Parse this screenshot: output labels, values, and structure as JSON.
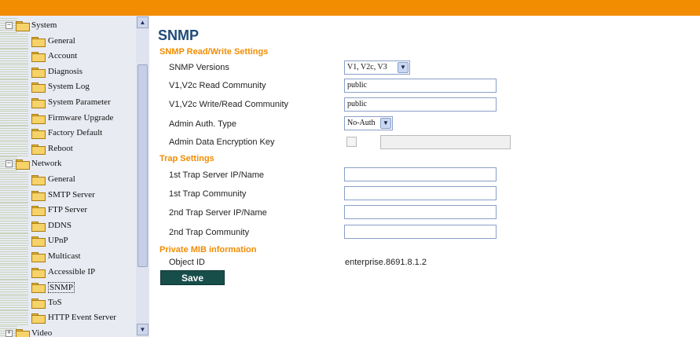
{
  "sidebar": {
    "items": [
      {
        "label": "System",
        "kind": "folder",
        "expander": "−"
      },
      {
        "label": "General",
        "kind": "page"
      },
      {
        "label": "Account",
        "kind": "page"
      },
      {
        "label": "Diagnosis",
        "kind": "page"
      },
      {
        "label": "System Log",
        "kind": "page"
      },
      {
        "label": "System Parameter",
        "kind": "page"
      },
      {
        "label": "Firmware Upgrade",
        "kind": "page"
      },
      {
        "label": "Factory Default",
        "kind": "page"
      },
      {
        "label": "Reboot",
        "kind": "page"
      },
      {
        "label": "Network",
        "kind": "folder",
        "expander": "−"
      },
      {
        "label": "General",
        "kind": "page"
      },
      {
        "label": "SMTP Server",
        "kind": "page"
      },
      {
        "label": "FTP Server",
        "kind": "page"
      },
      {
        "label": "DDNS",
        "kind": "page"
      },
      {
        "label": "UPnP",
        "kind": "page"
      },
      {
        "label": "Multicast",
        "kind": "page"
      },
      {
        "label": "Accessible IP",
        "kind": "page"
      },
      {
        "label": "SNMP",
        "kind": "page",
        "selected": true
      },
      {
        "label": "ToS",
        "kind": "page"
      },
      {
        "label": "HTTP Event Server",
        "kind": "page"
      },
      {
        "label": "Video",
        "kind": "folder",
        "expander": "+"
      }
    ],
    "scroll_up": "▲",
    "scroll_down": "▼"
  },
  "main": {
    "title": "SNMP",
    "rw_section": "SNMP Read/Write Settings",
    "snmp_versions_label": "SNMP Versions",
    "snmp_versions_value": "V1, V2c, V3",
    "read_community_label": "V1,V2c Read Community",
    "read_community_value": "public",
    "write_community_label": "V1,V2c Write/Read Community",
    "write_community_value": "public",
    "auth_type_label": "Admin Auth. Type",
    "auth_type_value": "No-Auth",
    "encryption_key_label": "Admin Data Encryption Key",
    "trap_section": "Trap Settings",
    "trap1_server_label": "1st Trap Server IP/Name",
    "trap1_server_value": "",
    "trap1_community_label": "1st Trap Community",
    "trap1_community_value": "",
    "trap2_server_label": "2nd Trap Server IP/Name",
    "trap2_server_value": "",
    "trap2_community_label": "2nd Trap Community",
    "trap2_community_value": "",
    "mib_section": "Private MIB information",
    "object_id_label": "Object ID",
    "object_id_value": "enterprise.8691.8.1.2",
    "save_label": "Save",
    "dropdown_glyph": "▼"
  },
  "colors": {
    "accent": "#f28c00",
    "title": "#1e4a78",
    "save_button": "#174e4a"
  }
}
